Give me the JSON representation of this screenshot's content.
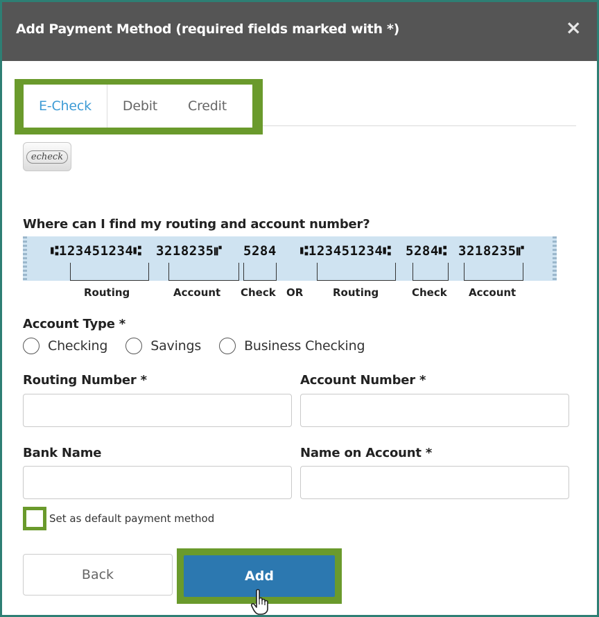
{
  "dialog": {
    "title": "Add Payment Method (required fields marked with *)",
    "close_glyph": "×"
  },
  "tabs": [
    {
      "label": "E-Check",
      "active": true
    },
    {
      "label": "Debit",
      "active": false
    },
    {
      "label": "Credit",
      "active": false
    }
  ],
  "echeck_logo_text": "echeck",
  "routing_help": {
    "question": "Where can I find my routing and account number?",
    "micr": {
      "left_routing": "⑆123451234⑆",
      "left_account": "3218235⑈",
      "left_check": "5284",
      "right_routing": "⑆123451234⑆",
      "right_check": "5284⑆",
      "right_account": "3218235⑈"
    },
    "labels": {
      "routing_1": "Routing",
      "account_1": "Account",
      "check_1": "Check",
      "or": "OR",
      "routing_2": "Routing",
      "check_2": "Check",
      "account_2": "Account"
    }
  },
  "account_type": {
    "label": "Account Type *",
    "options": [
      "Checking",
      "Savings",
      "Business Checking"
    ]
  },
  "fields": {
    "routing_number": {
      "label": "Routing Number *",
      "value": ""
    },
    "account_number": {
      "label": "Account Number *",
      "value": ""
    },
    "bank_name": {
      "label": "Bank Name",
      "value": ""
    },
    "name_on_account": {
      "label": "Name on Account *",
      "value": ""
    }
  },
  "default_checkbox": {
    "label": "Set as default payment method",
    "checked": false
  },
  "buttons": {
    "back": "Back",
    "add": "Add"
  },
  "colors": {
    "header": "#555555",
    "highlight": "#6a9a2c",
    "active_tab": "#3d9bd5",
    "add_button": "#2c78b0",
    "frame": "#2e7f74"
  }
}
